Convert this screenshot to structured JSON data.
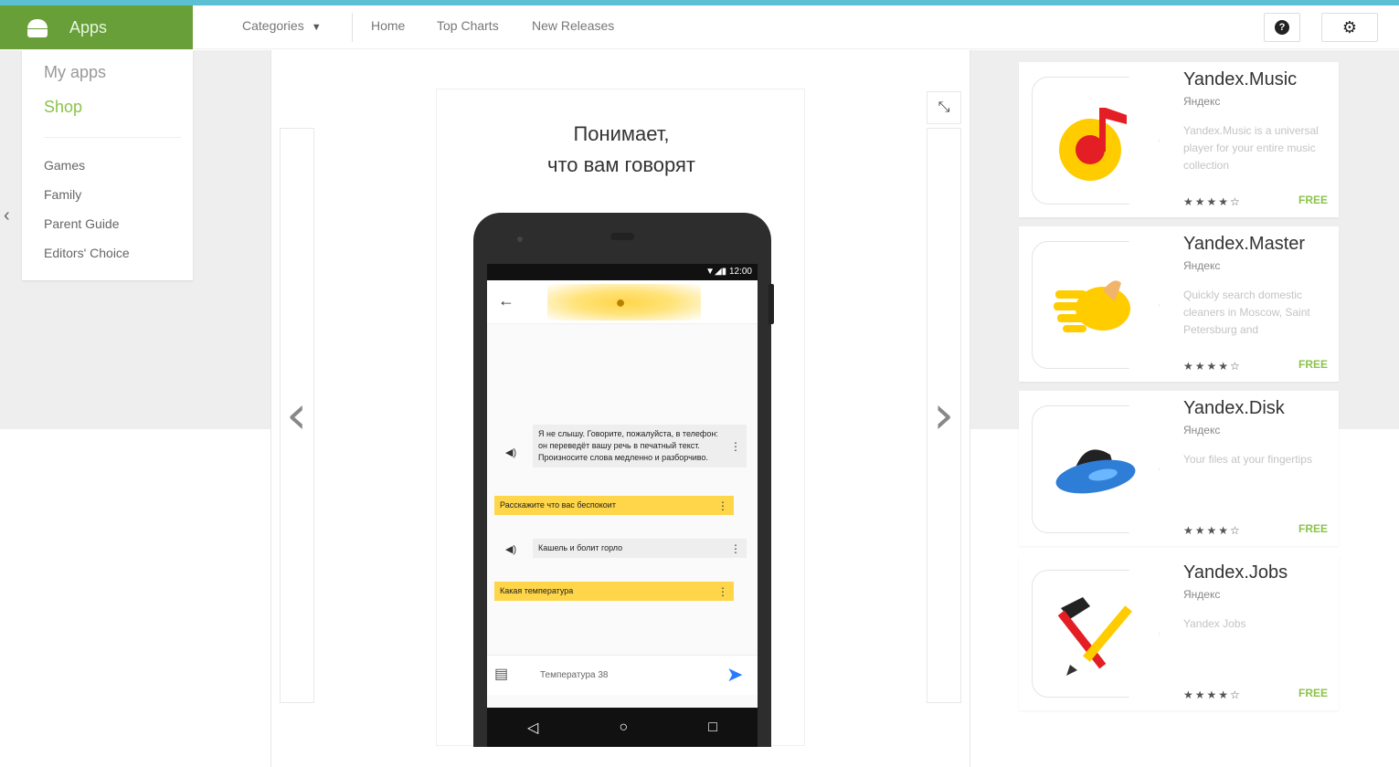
{
  "header": {
    "apps_label": "Apps",
    "categories_label": "Categories",
    "nav": [
      "Home",
      "Top Charts",
      "New Releases"
    ],
    "help_icon": "help-icon",
    "settings_icon": "gear-icon"
  },
  "sidebar": {
    "my_apps": "My apps",
    "shop": "Shop",
    "categories": [
      "Games",
      "Family",
      "Parent Guide",
      "Editors' Choice"
    ]
  },
  "screenshot": {
    "headline_line1": "Понимает,",
    "headline_line2": "что вам говорят",
    "status_time": "12:00",
    "messages": [
      {
        "type": "gray",
        "text": "Я не слышу. Говорите, пожалуйста, в телефон: он переведёт вашу речь в печатный текст. Произносите слова медленно и разборчиво."
      },
      {
        "type": "yellow",
        "text": "Расскажите что вас беспокоит"
      },
      {
        "type": "gray",
        "text": "Кашель и болит горло"
      },
      {
        "type": "yellow",
        "text": "Какая температура"
      }
    ],
    "input_text": "Температура 38"
  },
  "apps": [
    {
      "title": "Yandex.Music",
      "developer": "Яндекс",
      "description": "Yandex.Music is a universal player for your entire music collection",
      "rating": 4,
      "price": "FREE"
    },
    {
      "title": "Yandex.Master",
      "developer": "Яндекс",
      "description": "Quickly search domestic cleaners in Moscow, Saint Petersburg and",
      "rating": 4,
      "price": "FREE"
    },
    {
      "title": "Yandex.Disk",
      "developer": "Яндекс",
      "description": "Your files at your fingertips",
      "rating": 4,
      "price": "FREE"
    },
    {
      "title": "Yandex.Jobs",
      "developer": "Яндекс",
      "description": "Yandex Jobs",
      "rating": 4,
      "price": "FREE"
    }
  ],
  "colors": {
    "brand_green": "#689f38",
    "accent_green": "#8bc34a",
    "top_stripe": "#5bc0d4",
    "yellow": "#ffd54a"
  }
}
